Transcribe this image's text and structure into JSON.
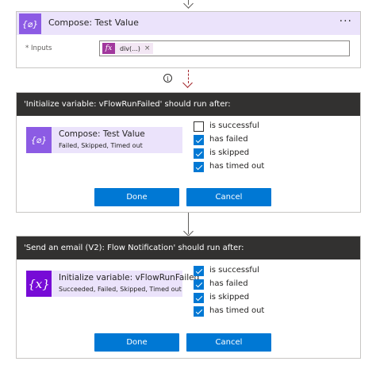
{
  "compose": {
    "title": "Compose: Test Value",
    "menu": "···",
    "inputs_label": "* Inputs",
    "token_label": "div(...)",
    "token_remove": "×",
    "icon_glyph": "{⌀}"
  },
  "info_icon": "i",
  "panel1": {
    "header": "'Initialize variable: vFlowRunFailed' should run after:",
    "action_title": "Compose: Test Value",
    "action_subtitle": "Failed, Skipped, Timed out",
    "action_icon_glyph": "{⌀}",
    "checks": [
      {
        "label": "is successful",
        "checked": false
      },
      {
        "label": "has failed",
        "checked": true
      },
      {
        "label": "is skipped",
        "checked": true
      },
      {
        "label": "has timed out",
        "checked": true
      }
    ],
    "done_label": "Done",
    "cancel_label": "Cancel"
  },
  "panel2": {
    "header": "'Send an email (V2): Flow Notification' should run after:",
    "action_title": "Initialize variable: vFlowRunFailed",
    "action_subtitle": "Succeeded, Failed, Skipped, Timed out",
    "action_icon_glyph": "{x}",
    "checks": [
      {
        "label": "is successful",
        "checked": true
      },
      {
        "label": "has failed",
        "checked": true
      },
      {
        "label": "is skipped",
        "checked": true
      },
      {
        "label": "has timed out",
        "checked": true
      }
    ],
    "done_label": "Done",
    "cancel_label": "Cancel"
  },
  "colors": {
    "compose_purple": "#8c5be4",
    "variable_purple": "#770bd6",
    "header_dark": "#323130",
    "primary_blue": "#0078d4",
    "dashed_red": "#a4262c"
  }
}
